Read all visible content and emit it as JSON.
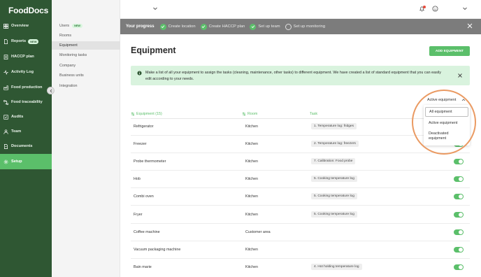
{
  "app": {
    "logo": "FoodDocs"
  },
  "sidebar": {
    "items": [
      {
        "label": "Overview",
        "icon": "dashboard-icon"
      },
      {
        "label": "Reports",
        "icon": "file-icon",
        "badge": "NEW"
      },
      {
        "label": "HACCP plan",
        "icon": "clipboard-icon"
      },
      {
        "label": "Activity Log",
        "icon": "activity-icon"
      },
      {
        "label": "Food production",
        "icon": "production-icon"
      },
      {
        "label": "Food traceability",
        "icon": "traceability-icon"
      },
      {
        "label": "Audits",
        "icon": "audit-icon"
      },
      {
        "label": "Team",
        "icon": "user-icon"
      },
      {
        "label": "Documents",
        "icon": "document-icon"
      },
      {
        "label": "Setup",
        "icon": "gear-icon",
        "active": true
      }
    ]
  },
  "subnav": {
    "items": [
      {
        "label": "Users",
        "badge": "NEW"
      },
      {
        "label": "Rooms"
      },
      {
        "label": "Equipment",
        "active": true
      },
      {
        "label": "Monitoring tasks"
      },
      {
        "label": "Company"
      },
      {
        "label": "Business units"
      },
      {
        "label": "Integration"
      }
    ]
  },
  "progress": {
    "title": "Your progress",
    "steps": [
      {
        "label": "Create location",
        "done": true
      },
      {
        "label": "Create HACCP plan",
        "done": true
      },
      {
        "label": "Set up team",
        "done": true
      },
      {
        "label": "Set up monitoring",
        "done": false
      }
    ]
  },
  "main": {
    "title": "Equipment",
    "add_button": "ADD EQUIPMENT",
    "info_text": "Make a list of all your equipment to assign the tasks (cleaning, maintenance, other tasks) to different equipment. We have created a list of standard equipment that you can easily edit according to your needs."
  },
  "filter": {
    "selected": "Active equipment",
    "options": [
      "All equipment",
      "Active equipment",
      "Deactivated equipment"
    ]
  },
  "table": {
    "headers": {
      "equipment": "Equipment (15)",
      "room": "Room",
      "task": "Task"
    },
    "rows": [
      {
        "name": "Refrigerator",
        "room": "Kitchen",
        "task": "1. Temperature log: fridges"
      },
      {
        "name": "Freezer",
        "room": "Kitchen",
        "task": "2. Temperature log: freezers"
      },
      {
        "name": "Probe thermometer",
        "room": "Kitchen",
        "task": "7. Calibration: Food probe"
      },
      {
        "name": "Hob",
        "room": "Kitchen",
        "task": "5. Cooking temperature log"
      },
      {
        "name": "Combi oven",
        "room": "Kitchen",
        "task": "5. Cooking temperature log"
      },
      {
        "name": "Fryer",
        "room": "Kitchen",
        "task": "5. Cooking temperature log"
      },
      {
        "name": "Coffee machine",
        "room": "Customer area",
        "task": ""
      },
      {
        "name": "Vacuum packaging machine",
        "room": "Kitchen",
        "task": ""
      },
      {
        "name": "Bain marie",
        "room": "Kitchen",
        "task": "4. Hot holding temperature log"
      }
    ]
  },
  "colors": {
    "sidebar": "#2f5733",
    "accent": "#5bbf6a",
    "progress_bar": "#7c7c7c",
    "info_bg": "#d9f3de",
    "highlight": "#ea9a62"
  }
}
